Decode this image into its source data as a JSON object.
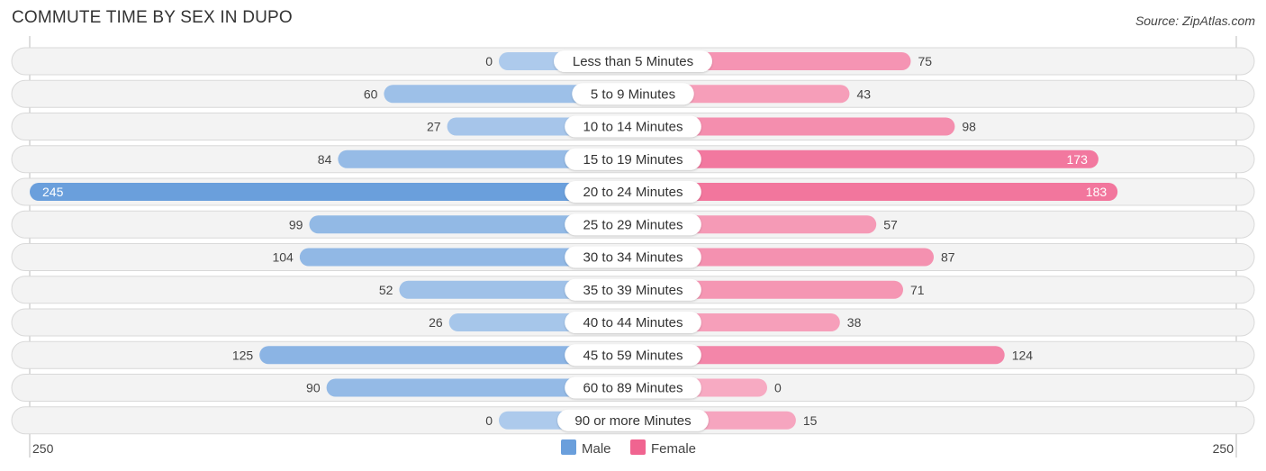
{
  "header": {
    "title": "COMMUTE TIME BY SEX IN DUPO",
    "source": "Source: ZipAtlas.com"
  },
  "chart_data": {
    "type": "bar",
    "orientation": "horizontal-diverging",
    "title": "COMMUTE TIME BY SEX IN DUPO",
    "categories": [
      "Less than 5 Minutes",
      "5 to 9 Minutes",
      "10 to 14 Minutes",
      "15 to 19 Minutes",
      "20 to 24 Minutes",
      "25 to 29 Minutes",
      "30 to 34 Minutes",
      "35 to 39 Minutes",
      "40 to 44 Minutes",
      "45 to 59 Minutes",
      "60 to 89 Minutes",
      "90 or more Minutes"
    ],
    "series": [
      {
        "name": "Male",
        "color": "#6a9fdc",
        "values": [
          0,
          60,
          27,
          84,
          245,
          99,
          104,
          52,
          26,
          125,
          90,
          0
        ]
      },
      {
        "name": "Female",
        "color": "#f06490",
        "values": [
          75,
          43,
          98,
          173,
          183,
          57,
          87,
          71,
          38,
          124,
          0,
          15
        ]
      }
    ],
    "axis": {
      "left_label": "250",
      "right_label": "250",
      "max": 250
    },
    "legend": {
      "position": "bottom-center",
      "items": [
        "Male",
        "Female"
      ]
    },
    "xlabel": "",
    "ylabel": ""
  }
}
